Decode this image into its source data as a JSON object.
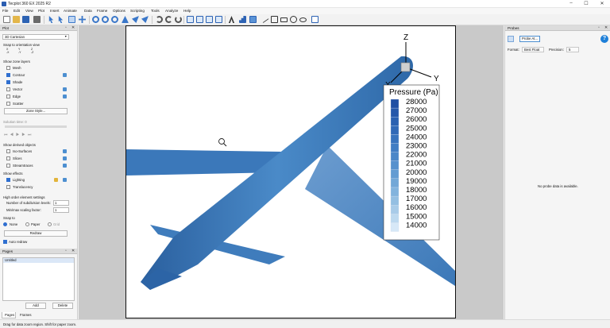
{
  "window": {
    "title": "Tecplot 360 EX 2025 R2",
    "minimize": "–",
    "maximize": "☐",
    "close": "✕"
  },
  "menu": [
    "File",
    "Edit",
    "View",
    "Plot",
    "Insert",
    "Animate",
    "Data",
    "Frame",
    "Options",
    "Scripting",
    "Tools",
    "Analyze",
    "Help"
  ],
  "plot_panel": {
    "title": "Plot",
    "plot_type": "3D Cartesian",
    "snap_label": "Snap to orientation view",
    "snap_axes": [
      "X",
      "Y",
      "Z",
      "-X",
      "-Y",
      "-Z"
    ],
    "zone_layers_label": "Show zone layers",
    "layers": [
      {
        "label": "Mesh",
        "checked": false
      },
      {
        "label": "Contour",
        "checked": true
      },
      {
        "label": "Shade",
        "checked": true
      },
      {
        "label": "Vector",
        "checked": false
      },
      {
        "label": "Edge",
        "checked": false
      },
      {
        "label": "Scatter",
        "checked": false
      }
    ],
    "zone_style_button": "Zone Style...",
    "solution_time_label": "Solution time: 0",
    "derived_label": "Show derived objects",
    "derived": [
      {
        "label": "Iso-Surfaces",
        "checked": false
      },
      {
        "label": "Slices",
        "checked": false
      },
      {
        "label": "Streamtraces",
        "checked": false
      }
    ],
    "effects_label": "Show effects",
    "effects": [
      {
        "label": "Lighting",
        "checked": true
      },
      {
        "label": "Translucency",
        "checked": false
      }
    ],
    "high_order_label": "High order element settings",
    "subdivision_label": "Number of subdivision levels:",
    "subdivision_value": "1",
    "scaling_label": "Min/max scaling factor:",
    "scaling_value": "1",
    "snap_to_label": "Snap to",
    "snap_to": [
      {
        "label": "None",
        "selected": true
      },
      {
        "label": "Paper",
        "selected": false
      },
      {
        "label": "Grid",
        "selected": false
      }
    ],
    "redraw_button": "Redraw",
    "auto_redraw_label": "Auto redraw",
    "auto_redraw_checked": true
  },
  "pages_panel": {
    "title": "Pages",
    "items": [
      "Untitled"
    ],
    "add_button": "Add",
    "delete_button": "Delete",
    "tabs": [
      "Pages",
      "Frames"
    ]
  },
  "probes_panel": {
    "title": "Probes",
    "probe_button": "Probe At...",
    "format_label": "Format:",
    "format_value": "Best Float",
    "precision_label": "Precision:",
    "precision_value": "5",
    "empty_message": "No probe data is available."
  },
  "axes": {
    "x": "X",
    "y": "Y",
    "z": "Z"
  },
  "legend": {
    "title": "Pressure (Pa)",
    "levels": [
      "28000",
      "27000",
      "26000",
      "25000",
      "24000",
      "23000",
      "22000",
      "21000",
      "20000",
      "19000",
      "18000",
      "17000",
      "16000",
      "15000",
      "14000"
    ],
    "colors": [
      "#1f4fa3",
      "#2558aa",
      "#2a61b1",
      "#3069b7",
      "#3873bd",
      "#417dc3",
      "#4c87c8",
      "#5791cd",
      "#649cd2",
      "#72a7d7",
      "#82b3dd",
      "#94bfe2",
      "#a8cbe8",
      "#bdd9ef",
      "#d7e8f7"
    ]
  },
  "status": {
    "message": "Drag for data zoom region. Shift for paper zoom."
  },
  "colors": {
    "accent": "#2f6fd0",
    "surface": "#3f7fc1"
  }
}
